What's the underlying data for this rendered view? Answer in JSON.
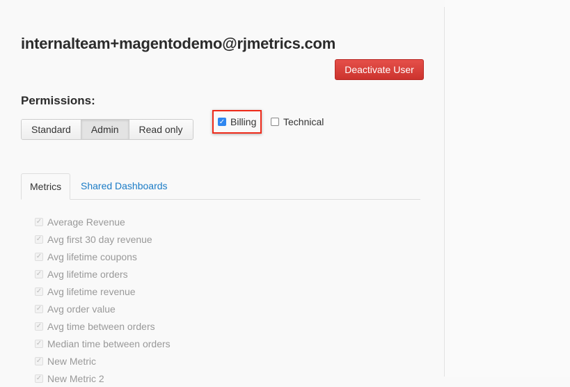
{
  "user": {
    "email": "internalteam+magentodemo@rjmetrics.com",
    "deactivate_label": "Deactivate User"
  },
  "permissions": {
    "title": "Permissions:",
    "roles": [
      "Standard",
      "Admin",
      "Read only"
    ],
    "selected_role": "Admin",
    "billing": {
      "label": "Billing",
      "checked": true
    },
    "technical": {
      "label": "Technical",
      "checked": false
    }
  },
  "tabs": [
    {
      "label": "Metrics",
      "active": true
    },
    {
      "label": "Shared Dashboards",
      "active": false
    }
  ],
  "metrics": [
    "Average Revenue",
    "Avg first 30 day revenue",
    "Avg lifetime coupons",
    "Avg lifetime orders",
    "Avg lifetime revenue",
    "Avg order value",
    "Avg time between orders",
    "Median time between orders",
    "New Metric",
    "New Metric 2"
  ],
  "colors": {
    "accent": "#1a7bc6",
    "danger": "#d63a34",
    "highlight": "#ee2a1a"
  }
}
